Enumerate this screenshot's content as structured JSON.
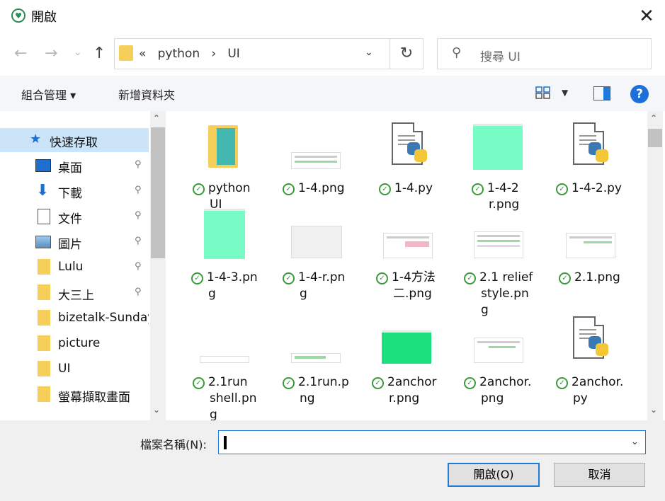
{
  "window": {
    "title": "開啟",
    "close_glyph": "✕"
  },
  "nav": {
    "back_glyph": "←",
    "forward_glyph": "→",
    "recent_glyph": "⌄",
    "up_glyph": "↑",
    "breadcrumb_sep": "«",
    "crumbs": [
      "python",
      "UI"
    ],
    "crumb_arrow": "›",
    "refresh_glyph": "↻",
    "search_placeholder": "搜尋 UI"
  },
  "toolbar": {
    "organize": "組合管理 ▾",
    "new_folder": "新增資料夾",
    "help": "?"
  },
  "sidebar": {
    "items": [
      {
        "label": "快速存取",
        "icon": "star-icon",
        "pinned": false,
        "selected": true
      },
      {
        "label": "桌面",
        "icon": "desktop-icon",
        "pinned": true
      },
      {
        "label": "下載",
        "icon": "download-icon",
        "pinned": true
      },
      {
        "label": "文件",
        "icon": "document-icon",
        "pinned": true
      },
      {
        "label": "圖片",
        "icon": "pictures-icon",
        "pinned": true
      },
      {
        "label": "Lulu",
        "icon": "folder-icon",
        "pinned": true
      },
      {
        "label": "大三上",
        "icon": "folder-icon",
        "pinned": true
      },
      {
        "label": "bizetalk-Sunday",
        "icon": "folder-icon",
        "pinned": false
      },
      {
        "label": "picture",
        "icon": "folder-icon",
        "pinned": false
      },
      {
        "label": "UI",
        "icon": "folder-icon",
        "pinned": false
      },
      {
        "label": "螢幕擷取畫面",
        "icon": "folder-icon",
        "pinned": false
      }
    ],
    "pin_glyph": "📌"
  },
  "files": [
    {
      "name_line1": "python",
      "name_line2": "UI",
      "name_line3": "",
      "kind": "folder"
    },
    {
      "name_line1": "1-4.png",
      "name_line2": "",
      "name_line3": "",
      "kind": "screenshot"
    },
    {
      "name_line1": "1-4.py",
      "name_line2": "",
      "name_line3": "",
      "kind": "python"
    },
    {
      "name_line1": "1-4-2",
      "name_line2": "r.png",
      "name_line3": "",
      "kind": "green-image"
    },
    {
      "name_line1": "1-4-2.py",
      "name_line2": "",
      "name_line3": "",
      "kind": "python"
    },
    {
      "name_line1": "1-4-3.pn",
      "name_line2": "g",
      "name_line3": "",
      "kind": "green-image-tall"
    },
    {
      "name_line1": "1-4-r.pn",
      "name_line2": "g",
      "name_line3": "",
      "kind": "gray-image"
    },
    {
      "name_line1": "1-4方法",
      "name_line2": "二.png",
      "name_line3": "",
      "kind": "screenshot"
    },
    {
      "name_line1": "2.1 relief",
      "name_line2": "style.pn",
      "name_line3": "g",
      "kind": "screenshot"
    },
    {
      "name_line1": "2.1.png",
      "name_line2": "",
      "name_line3": "",
      "kind": "screenshot"
    },
    {
      "name_line1": "2.1run",
      "name_line2": "shell.pn",
      "name_line3": "g",
      "kind": "strip"
    },
    {
      "name_line1": "2.1run.p",
      "name_line2": "ng",
      "name_line3": "",
      "kind": "strip-green"
    },
    {
      "name_line1": "2anchor",
      "name_line2": "r.png",
      "name_line3": "",
      "kind": "bright-green"
    },
    {
      "name_line1": "2anchor.",
      "name_line2": "png",
      "name_line3": "",
      "kind": "screenshot"
    },
    {
      "name_line1": "2anchor.",
      "name_line2": "py",
      "name_line3": "",
      "kind": "python"
    }
  ],
  "bottom": {
    "filename_label": "檔案名稱(N):",
    "filename_value": "",
    "open_label": "開啟(O)",
    "cancel_label": "取消"
  },
  "colors": {
    "accent": "#1f7ad9",
    "selection": "#cce4f7",
    "folder": "#f6cf5a",
    "mint": "#78fbc4",
    "check": "#3a9a3a"
  }
}
